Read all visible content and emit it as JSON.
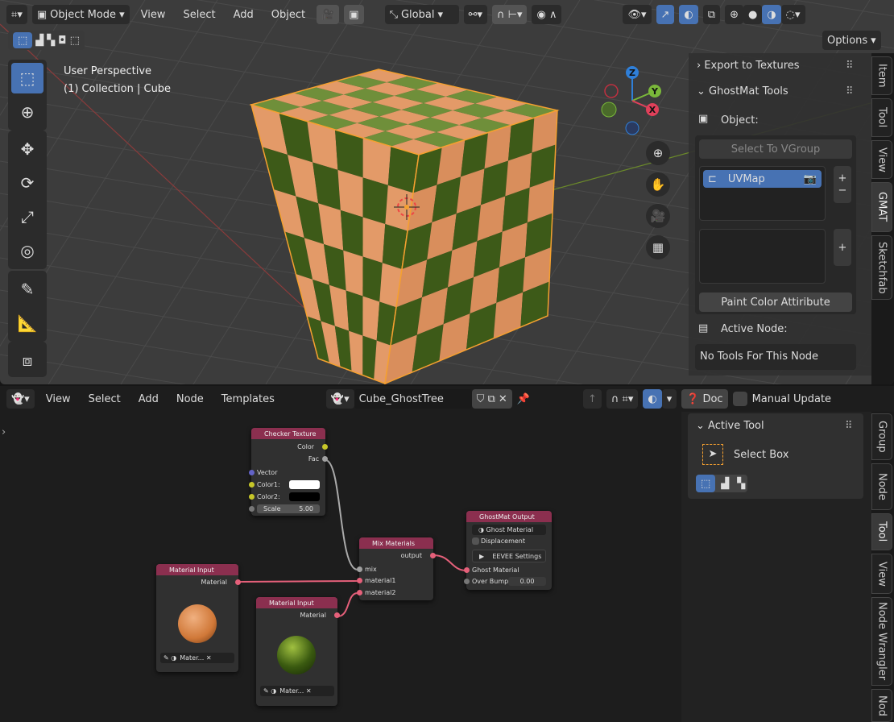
{
  "viewport": {
    "header": {
      "mode": "Object Mode",
      "menus": [
        "View",
        "Select",
        "Add",
        "Object"
      ],
      "orientation": "Global",
      "options": "Options"
    },
    "overlay": {
      "perspective": "User Perspective",
      "collection": "(1) Collection | Cube"
    },
    "gizmo": {
      "z": "Z",
      "y": "Y",
      "x": "X"
    },
    "sidebar": {
      "export_panel": "Export to Textures",
      "ghostmat_panel": "GhostMat Tools",
      "object_label": "Object:",
      "select_vgroup": "Select To VGroup",
      "uvmap": "UVMap",
      "paint_button": "Paint Color Attiribute",
      "active_node_label": "Active Node:",
      "no_tools": "No Tools For This Node"
    },
    "tabs": [
      "Item",
      "Tool",
      "View",
      "GMAT",
      "Sketchfab"
    ],
    "active_tab": "GMAT"
  },
  "node_editor": {
    "header": {
      "menus": [
        "View",
        "Select",
        "Add",
        "Node",
        "Templates"
      ],
      "tree_name": "Cube_GhostTree",
      "doc": "Doc",
      "manual_update": "Manual Update"
    },
    "sidebar": {
      "active_tool_panel": "Active Tool",
      "tool_name": "Select Box"
    },
    "tabs": [
      "Group",
      "Node",
      "Tool",
      "View",
      "Node Wrangler",
      "Nod"
    ],
    "active_tab": "Tool",
    "nodes": {
      "checker": {
        "title": "Checker Texture",
        "color": "Color",
        "fac": "Fac",
        "vector": "Vector",
        "color1": "Color1:",
        "color2": "Color2:",
        "scale_label": "Scale",
        "scale": "5.00"
      },
      "mix": {
        "title": "Mix Materials",
        "output": "output",
        "mix": "mix",
        "m1": "material1",
        "m2": "material2"
      },
      "output": {
        "title": "GhostMat Output",
        "material": "Ghost Material",
        "displacement": "Displacement",
        "eevee": "EEVEE Settings",
        "ghost_in": "Ghost Material",
        "bump_label": "Over Bump",
        "bump": "0.00"
      },
      "mat1": {
        "title": "Material Input",
        "socket": "Material",
        "name": "Mater..."
      },
      "mat2": {
        "title": "Material Input",
        "socket": "Material",
        "name": "Mater..."
      }
    }
  },
  "colors": {
    "accent": "#4772b3",
    "node_header": "#8b2f4f",
    "selection": "#f5a030",
    "material_socket": "#e5607a"
  }
}
